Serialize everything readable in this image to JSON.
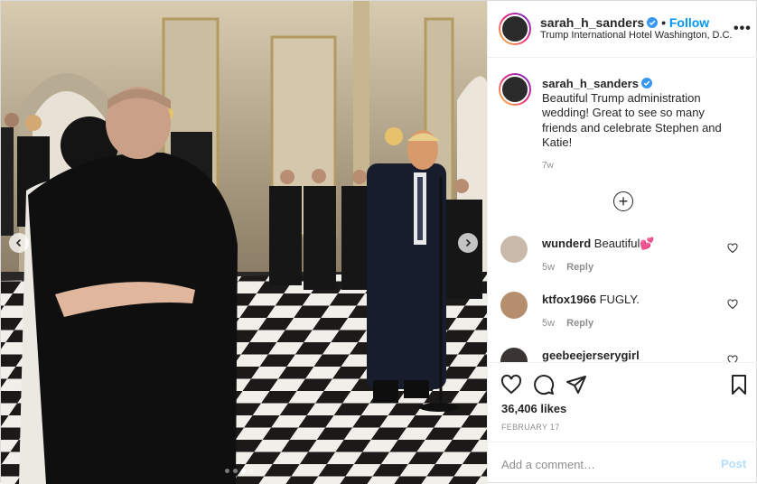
{
  "post": {
    "username": "sarah_h_sanders",
    "separator": "•",
    "follow_label": "Follow",
    "location": "Trump International Hotel Washington, D.C.",
    "more_icon": "more-horizontal-icon",
    "verified_icon": "verified-badge-icon",
    "carousel": {
      "slide_count": 4,
      "active_slide": 3
    }
  },
  "caption": {
    "username": "sarah_h_sanders",
    "text": "Beautiful Trump administration wedding! Great to see so many friends and celebrate Stephen and Katie!",
    "time": "7w"
  },
  "comments": [
    {
      "username": "wunderd",
      "text": "Beautiful💕",
      "time": "5w",
      "reply_label": "Reply"
    },
    {
      "username": "ktfox1966",
      "text": "FUGLY.",
      "time": "5w",
      "reply_label": "Reply"
    },
    {
      "username": "geebeejerserygirl",
      "text": "",
      "time": "",
      "reply_label": ""
    }
  ],
  "actions": {
    "likes": "36,406 likes",
    "date": "FEBRUARY 17"
  },
  "add_comment": {
    "placeholder": "Add a comment…",
    "post_label": "Post"
  },
  "colors": {
    "accent": "#0095f6",
    "post_disabled": "#b2dffc",
    "muted": "#8e8e8e",
    "text": "#262626"
  }
}
